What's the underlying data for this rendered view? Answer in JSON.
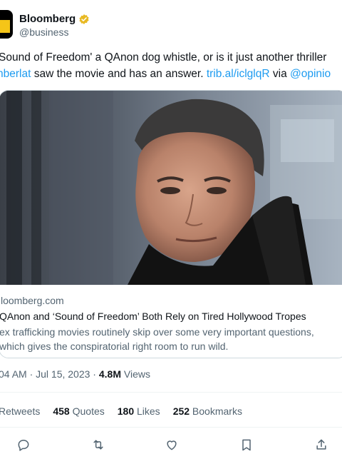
{
  "author": {
    "name": "Bloomberg",
    "handle": "@business"
  },
  "tweet": {
    "line1": "Sound of Freedom' a QAnon dog whistle, or is it just another thriller",
    "line2_prefix": "nberlat",
    "line2_text": " saw the movie and has an answer. ",
    "link": "trib.al/iclglqR",
    "via": " via ",
    "mention": "@opinio"
  },
  "card": {
    "domain": "loomberg.com",
    "title": "QAnon and ‘Sound of Freedom’ Both Rely on Tired Hollywood Tropes",
    "desc1": "ex trafficking movies routinely skip over some very important questions,",
    "desc2": "which gives the conspiratorial right room to run wild."
  },
  "meta": {
    "time": "04 AM · Jul 15, 2023 · ",
    "views_count": "4.8M",
    "views_label": " Views"
  },
  "stats": {
    "retweets_label": "Retweets",
    "quotes_count": "458",
    "quotes_label": " Quotes",
    "likes_count": "180",
    "likes_label": " Likes",
    "bookmarks_count": "252",
    "bookmarks_label": " Bookmarks"
  },
  "colors": {
    "accent": "#1d9bf0",
    "verified": "#e8b923",
    "muted": "#536471"
  },
  "icons": [
    "reply-icon",
    "retweet-icon",
    "like-icon",
    "bookmark-icon",
    "share-icon"
  ]
}
